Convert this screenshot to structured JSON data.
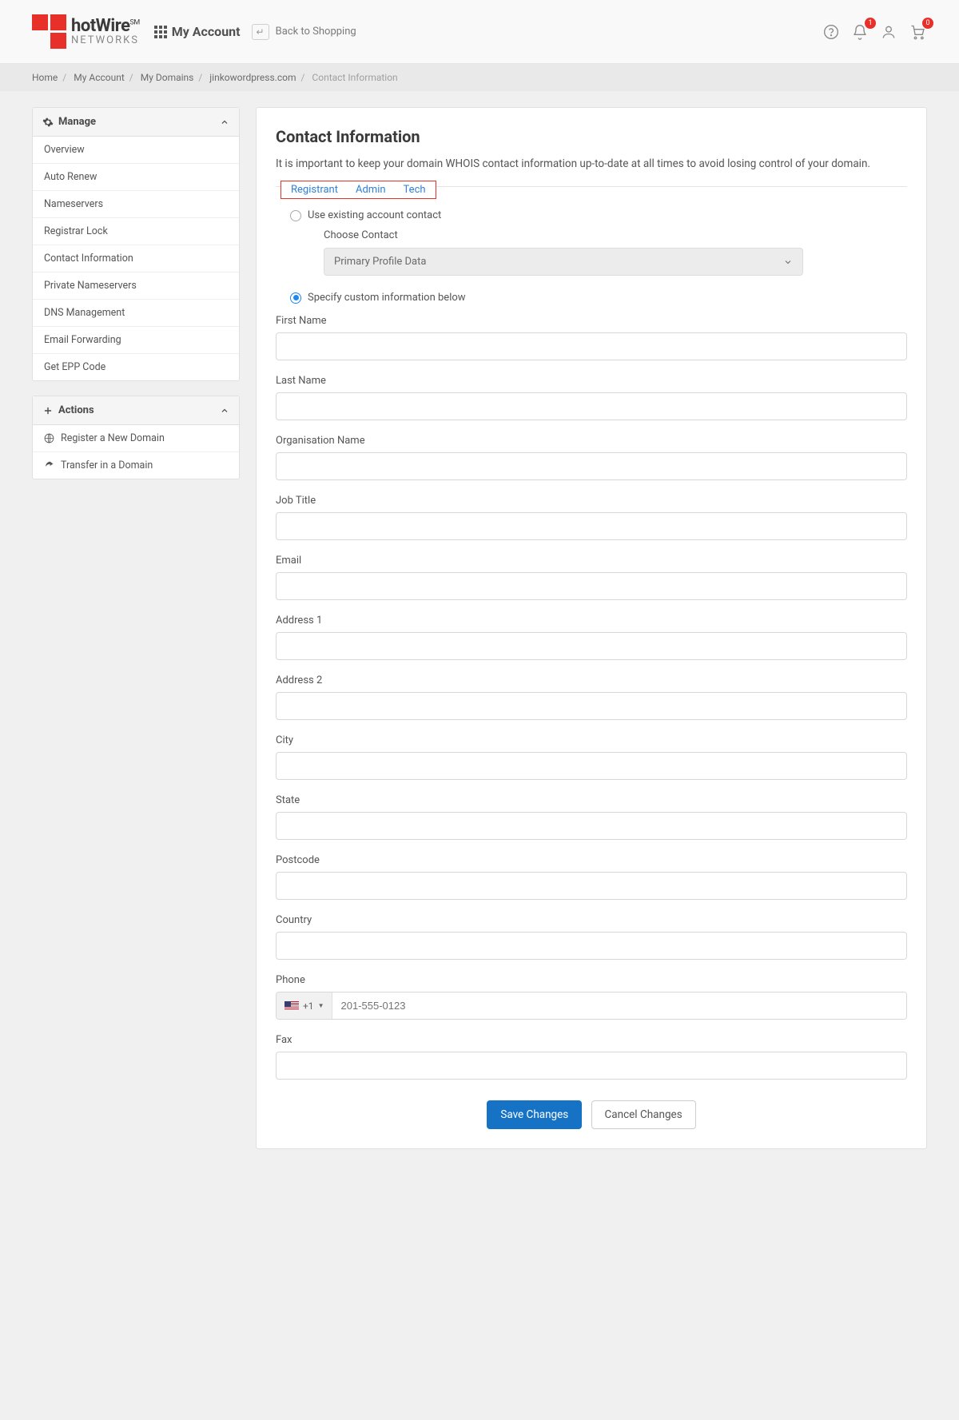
{
  "header": {
    "brand_line1": "hotWire",
    "brand_sup": "SM",
    "brand_line2": "NETWORKS",
    "app_title": "My Account",
    "back_label": "Back to Shopping",
    "notif_count": "1",
    "cart_count": "0"
  },
  "breadcrumb": {
    "items": [
      "Home",
      "My Account",
      "My Domains",
      "jinkowordpress.com",
      "Contact Information"
    ]
  },
  "sidebar": {
    "manage_title": "Manage",
    "manage_items": [
      "Overview",
      "Auto Renew",
      "Nameservers",
      "Registrar Lock",
      "Contact Information",
      "Private Nameservers",
      "DNS Management",
      "Email Forwarding",
      "Get EPP Code"
    ],
    "actions_title": "Actions",
    "actions_items": [
      "Register a New Domain",
      "Transfer in a Domain"
    ]
  },
  "main": {
    "title": "Contact Information",
    "intro": "It is important to keep your domain WHOIS contact information up-to-date at all times to avoid losing control of your domain.",
    "tabs": [
      "Registrant",
      "Admin",
      "Tech"
    ],
    "opt_existing": "Use existing account contact",
    "choose_label": "Choose Contact",
    "choose_value": "Primary Profile Data",
    "opt_custom": "Specify custom information below",
    "fields": {
      "first_name": "First Name",
      "last_name": "Last Name",
      "org": "Organisation Name",
      "job": "Job Title",
      "email": "Email",
      "addr1": "Address 1",
      "addr2": "Address 2",
      "city": "City",
      "state": "State",
      "postcode": "Postcode",
      "country": "Country",
      "phone": "Phone",
      "fax": "Fax"
    },
    "phone_code": "+1",
    "phone_placeholder": "201-555-0123",
    "save_btn": "Save Changes",
    "cancel_btn": "Cancel Changes"
  }
}
